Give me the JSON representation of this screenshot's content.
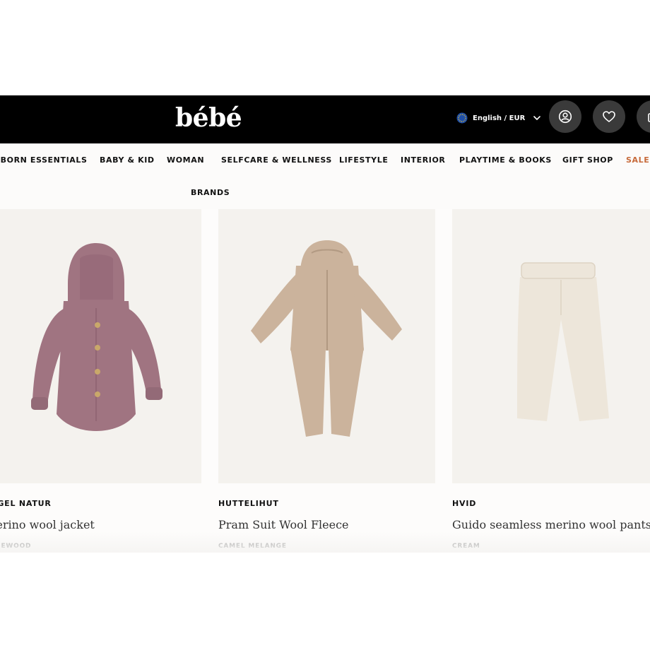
{
  "header": {
    "logo": "bébé",
    "language": "English / EUR",
    "icons": [
      "globe-icon",
      "chevron-down-icon",
      "account-icon",
      "heart-icon",
      "bag-icon"
    ],
    "background": "#000000"
  },
  "nav": {
    "items": [
      {
        "label": "NEWBORN ESSENTIALS"
      },
      {
        "label": "BABY & KID"
      },
      {
        "label": "WOMAN"
      },
      {
        "label": "SELFCARE & WELLNESS"
      },
      {
        "label": "LIFESTYLE"
      },
      {
        "label": "INTERIOR"
      },
      {
        "label": "PLAYTIME & BOOKS"
      },
      {
        "label": "GIFT SHOP"
      },
      {
        "label": "SALE"
      },
      {
        "label": "BRANDS"
      }
    ],
    "sale_color": "#c76a3a"
  },
  "products": [
    {
      "brand": "ENGEL NATUR",
      "name": "Merino wool jacket",
      "color": "ROSEWOOD",
      "garment_color": "#a07481"
    },
    {
      "brand": "HUTTELIHUT",
      "name": "Pram Suit Wool Fleece",
      "color": "CAMEL MELANGE",
      "garment_color": "#cbb39c"
    },
    {
      "brand": "HVID",
      "name": "Guido seamless merino wool pants",
      "color": "CREAM",
      "garment_color": "#ede6da"
    }
  ]
}
